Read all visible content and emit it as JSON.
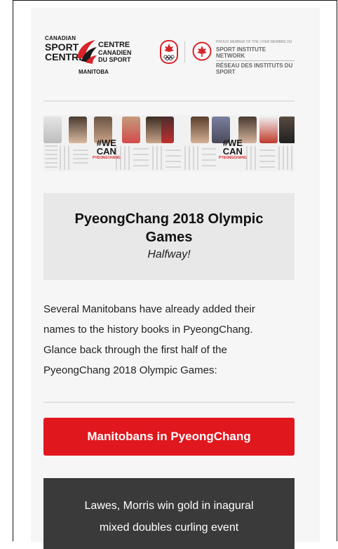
{
  "header": {
    "csc": {
      "left_line1": "CANADIAN",
      "left_line2": "SPORT",
      "left_line3": "CENTRE",
      "right_line1": "CENTRE",
      "right_line2": "CANADIEN",
      "right_line3": "DU SPORT",
      "region": "MANITOBA"
    },
    "sin": {
      "line1": "PROUD MEMBER OF THE | FIER MEMBRE DU",
      "line2": "SPORT INSTITUTE NETWORK",
      "line3": "RÉSEAU DES INSTITUTS DU SPORT"
    }
  },
  "banner": {
    "hashtag_we": "#WE",
    "hashtag_can": "CAN",
    "hashtag_sub": "PYEONGCHANG"
  },
  "title_box": {
    "title": "PyeongChang 2018 Olympic Games",
    "subtitle": "Halfway!"
  },
  "intro": {
    "line1": "Several Manitobans have already added their",
    "line2": "names to the history books in PyeongChang.",
    "line3": "Glance back through the first half of the",
    "line4": "PyeongChang 2018 Olympic Games:"
  },
  "cta": {
    "label": "Manitobans in PyeongChang"
  },
  "news": {
    "line1": "Lawes, Morris win gold in inagural",
    "line2": "mixed doubles curling event"
  },
  "colors": {
    "accent_red": "#e1171e",
    "dark_box": "#3a3a3a",
    "title_box": "#e8e8e8",
    "card": "#f6f6f6"
  }
}
